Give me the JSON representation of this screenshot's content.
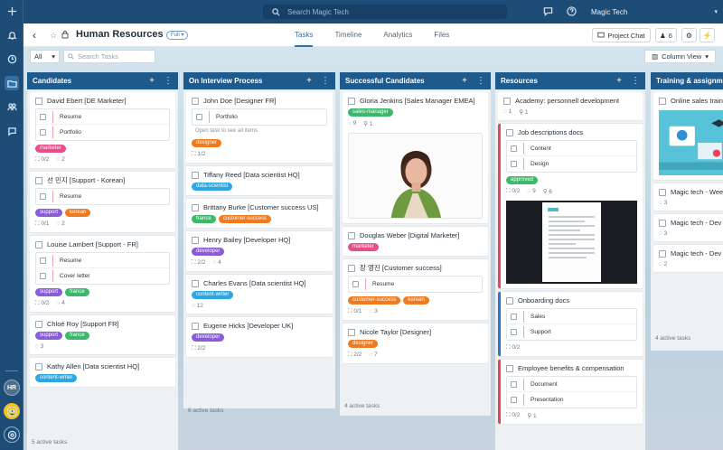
{
  "app": {
    "search_placeholder": "Search Magic Tech",
    "workspace": "Magic Tech",
    "user_initials": "HR"
  },
  "header": {
    "title": "Human Resources",
    "badge": "Full",
    "tabs": [
      "Tasks",
      "Timeline",
      "Analytics",
      "Files"
    ],
    "active_tab": "Tasks",
    "project_chat": "Project Chat",
    "member_count": "6"
  },
  "toolbar": {
    "filter_value": "All",
    "search_placeholder": "Search Tasks",
    "column_view": "Column View"
  },
  "colors": {
    "marketer": "#e84e8a",
    "support": "#8a5cd6",
    "korean": "#f07a1e",
    "france": "#3cb86a",
    "content-writer": "#2fa6e0",
    "designer": "#f07a1e",
    "data-scientist": "#2fa6e0",
    "customer-success": "#f07a1e",
    "developer": "#8a5cd6",
    "sales-manager": "#3cb86a",
    "approved": "#3cb86a"
  },
  "columns": [
    {
      "title": "Candidates",
      "footer": "5 active tasks",
      "cards": [
        {
          "title": "David Ebert [DE Marketer]",
          "subtasks": [
            "Resume",
            "Portfolio"
          ],
          "tags": [
            "marketer"
          ],
          "meta": [
            "0/2",
            "2"
          ]
        },
        {
          "title": "선 민지 [Support - Korean]",
          "subtasks": [
            "Resume"
          ],
          "tags": [
            "support",
            "korean"
          ],
          "meta": [
            "0/1",
            "2"
          ]
        },
        {
          "title": "Louise Lambert [Support - FR]",
          "subtasks": [
            "Resume",
            "Cover letter"
          ],
          "tags": [
            "support",
            "france"
          ],
          "meta": [
            "0/2",
            "4"
          ]
        },
        {
          "title": "Chloé Roy [Support FR]",
          "tags": [
            "support",
            "france"
          ],
          "meta": [
            "3"
          ]
        },
        {
          "title": "Kathy Allen [Data scientist HQ]",
          "tags": [
            "content-writer"
          ]
        }
      ]
    },
    {
      "title": "On Interview Process",
      "footer": "6 active tasks",
      "cards": [
        {
          "title": "John Doe [Designer FR]",
          "subtasks": [
            "Portfolio"
          ],
          "note": "Open task to see all items",
          "tags": [
            "designer"
          ],
          "meta": [
            "1/2"
          ]
        },
        {
          "title": "Tiffany Reed [Data scientist HQ]",
          "tags": [
            "data-scientist"
          ]
        },
        {
          "title": "Brittany Burke [Customer success US]",
          "tags": [
            "france",
            "customer-success"
          ]
        },
        {
          "title": "Henry Bailey [Developer HQ]",
          "tags": [
            "developer"
          ],
          "meta": [
            "2/2",
            "4"
          ]
        },
        {
          "title": "Charles Evans [Data scientist HQ]",
          "tags": [
            "content-writer"
          ],
          "meta": [
            "12"
          ]
        },
        {
          "title": "Eugene Hicks [Developer UK]",
          "tags": [
            "developer"
          ],
          "meta": [
            "2/2"
          ]
        }
      ]
    },
    {
      "title": "Successful Candidates",
      "footer": "4 active tasks",
      "cards": [
        {
          "title": "Gloria Jenkins [Sales Manager EMEA]",
          "tags": [
            "sales-manager"
          ],
          "meta": [
            "9",
            "1"
          ]
        },
        {
          "title": "Douglas Weber [Digital Marketer]",
          "tags": [
            "marketer"
          ]
        },
        {
          "title": "장 영진 [Customer success]",
          "subtasks": [
            "Resume"
          ],
          "tags": [
            "customer-success",
            "korean"
          ],
          "meta": [
            "0/1",
            "3"
          ]
        },
        {
          "title": "Nicole Taylor [Designer]",
          "tags": [
            "designer"
          ],
          "meta": [
            "2/2",
            "7"
          ]
        }
      ]
    },
    {
      "title": "Resources",
      "cards": [
        {
          "title": "Academy: personnell development",
          "meta": [
            "1",
            "1"
          ]
        },
        {
          "title": "Job descriptions docs",
          "subtasks": [
            "Content",
            "Design"
          ],
          "tags": [
            "approved"
          ],
          "meta": [
            "0/2",
            "9",
            "6"
          ]
        },
        {
          "title": "Onboarding docs",
          "subtasks": [
            "Sales",
            "Support"
          ],
          "meta": [
            "0/2"
          ]
        },
        {
          "title": "Employee benefits & compensation",
          "subtasks": [
            "Document",
            "Presentation"
          ],
          "meta": [
            "0/2",
            "1"
          ]
        }
      ]
    },
    {
      "title": "Training & assignments",
      "footer": "4 active tasks",
      "cards": [
        {
          "title": "Online sales training",
          "meta": []
        },
        {
          "title": "Magic tech - Weekly",
          "meta": [
            "3"
          ]
        },
        {
          "title": "Magic tech - Dev",
          "meta": [
            "3"
          ]
        },
        {
          "title": "Magic tech - Dev",
          "meta": [
            "2"
          ]
        }
      ]
    }
  ]
}
